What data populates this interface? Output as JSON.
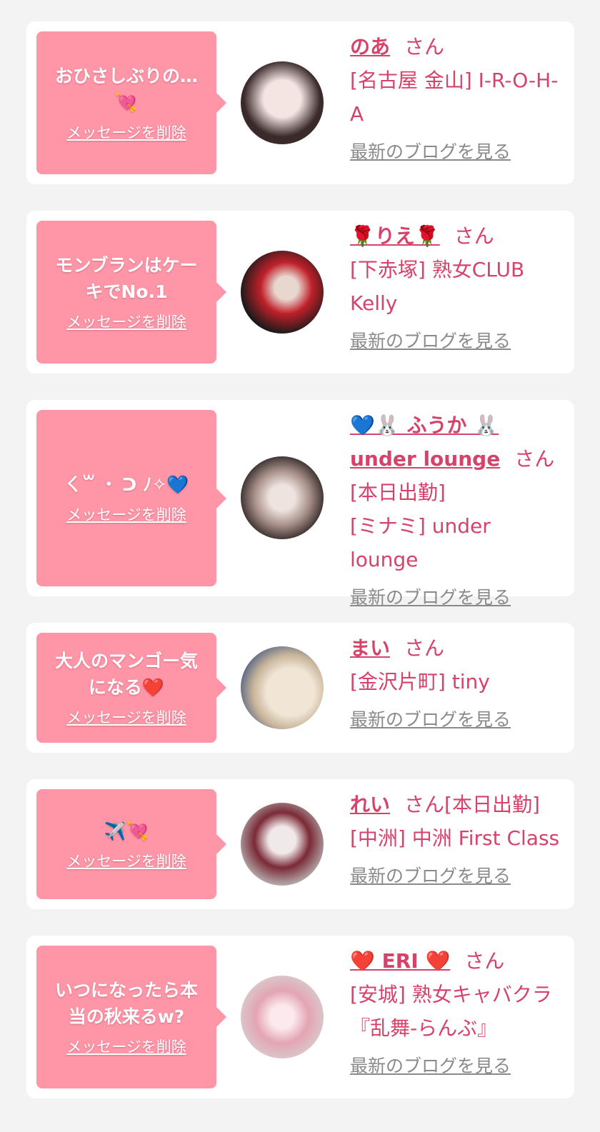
{
  "cards": [
    {
      "message_lines": [
        "おひさしぶりの…",
        "💘"
      ],
      "delete_label": "メッセージを削除",
      "name": "のあ",
      "honorific": "さん",
      "shop_lines": [
        "[名古屋 金山] I-R-O-H-",
        "A"
      ],
      "blog_label": "最新のブログを見る",
      "avatar_colors": [
        "#e8d6d6",
        "#3a2a2a"
      ]
    },
    {
      "message_lines": [
        "モンブランはケー",
        "キでNo.1"
      ],
      "delete_label": "メッセージを削除",
      "name": "🌹りえ🌹",
      "honorific": "さん",
      "shop_lines": [
        "[下赤塚] 熟女CLUB",
        "Kelly"
      ],
      "blog_label": "最新のブログを見る",
      "avatar_colors": [
        "#c0202a",
        "#1a1a1a"
      ]
    },
    {
      "message_lines": [
        "ㄑ꒳ ・ ᑐ ﾉ✧💙"
      ],
      "delete_label": "メッセージを削除",
      "name_lines": [
        "💙🐰 ふうか 🐰",
        "under lounge"
      ],
      "honorific": "さん",
      "shop_lines": [
        "[本日出勤]",
        "[ミナミ] under lounge"
      ],
      "blog_label": "最新のブログを見る",
      "avatar_colors": [
        "#bfa6a0",
        "#3a2e2e"
      ]
    },
    {
      "message_lines": [
        "大人のマンゴー気",
        "になる❤️"
      ],
      "delete_label": "メッセージを削除",
      "name": "まい",
      "honorific": "さん",
      "shop_lines": [
        "[金沢片町] tiny"
      ],
      "blog_label": "最新のブログを見る",
      "avatar_colors": [
        "#e9dcc8",
        "#2f4a7a"
      ]
    },
    {
      "message_lines": [
        "✈️💘"
      ],
      "delete_label": "メッセージを削除",
      "name": "れい",
      "honorific": "さん[本日出勤]",
      "shop_lines": [
        "[中洲] 中洲 First Class"
      ],
      "blog_label": "最新のブログを見る",
      "avatar_colors": [
        "#cfcfcf",
        "#b0243a"
      ]
    },
    {
      "message_lines": [
        "いつになったら本",
        "当の秋来るw?"
      ],
      "delete_label": "メッセージを削除",
      "name": "❤️ ERI ❤️",
      "honorific": "さん",
      "shop_lines": [
        "[安城] 熟女キャバクラ",
        "『乱舞-らんぶ』"
      ],
      "blog_label": "最新のブログを見る",
      "avatar_colors": [
        "#f3c9cf",
        "#d98a9a"
      ]
    }
  ]
}
